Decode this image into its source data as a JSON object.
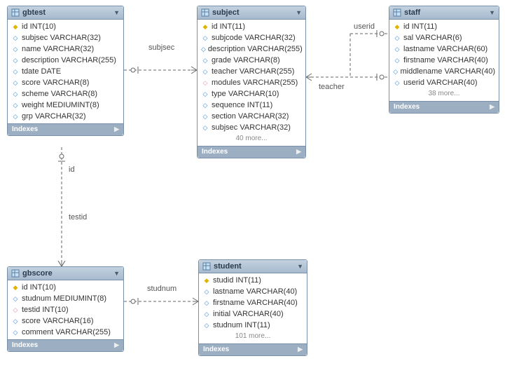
{
  "tables": {
    "gbtest": {
      "title": "gbtest",
      "columns": [
        {
          "icon": "pk",
          "text": "id INT(10)"
        },
        {
          "icon": "fld",
          "text": "subjsec VARCHAR(32)"
        },
        {
          "icon": "fld",
          "text": "name VARCHAR(32)"
        },
        {
          "icon": "fld",
          "text": "description VARCHAR(255)"
        },
        {
          "icon": "fld",
          "text": "tdate DATE"
        },
        {
          "icon": "fld",
          "text": "score VARCHAR(8)"
        },
        {
          "icon": "fld",
          "text": "scheme VARCHAR(8)"
        },
        {
          "icon": "fld",
          "text": "weight MEDIUMINT(8)"
        },
        {
          "icon": "fld",
          "text": "grp VARCHAR(32)"
        }
      ],
      "more": null,
      "footer": "Indexes"
    },
    "subject": {
      "title": "subject",
      "columns": [
        {
          "icon": "pk",
          "text": "id INT(11)"
        },
        {
          "icon": "fld",
          "text": "subjcode VARCHAR(32)"
        },
        {
          "icon": "fld",
          "text": "description VARCHAR(255)"
        },
        {
          "icon": "fld",
          "text": "grade VARCHAR(8)"
        },
        {
          "icon": "fld",
          "text": "teacher VARCHAR(255)"
        },
        {
          "icon": "fld-open",
          "text": "modules VARCHAR(255)"
        },
        {
          "icon": "fld",
          "text": "type VARCHAR(10)"
        },
        {
          "icon": "fld",
          "text": "sequence INT(11)"
        },
        {
          "icon": "fld",
          "text": "section VARCHAR(32)"
        },
        {
          "icon": "fld",
          "text": "subjsec VARCHAR(32)"
        }
      ],
      "more": "40 more...",
      "footer": "Indexes"
    },
    "staff": {
      "title": "staff",
      "columns": [
        {
          "icon": "pk",
          "text": "id INT(11)"
        },
        {
          "icon": "fld",
          "text": "sal VARCHAR(6)"
        },
        {
          "icon": "fld",
          "text": "lastname VARCHAR(60)"
        },
        {
          "icon": "fld",
          "text": "firstname VARCHAR(40)"
        },
        {
          "icon": "fld",
          "text": "middlename VARCHAR(40)"
        },
        {
          "icon": "fld",
          "text": "userid VARCHAR(40)"
        }
      ],
      "more": "38 more...",
      "footer": "Indexes"
    },
    "gbscore": {
      "title": "gbscore",
      "columns": [
        {
          "icon": "pk",
          "text": "id INT(10)"
        },
        {
          "icon": "fld",
          "text": "studnum MEDIUMINT(8)"
        },
        {
          "icon": "fld-open",
          "text": "testid INT(10)"
        },
        {
          "icon": "fld",
          "text": "score VARCHAR(16)"
        },
        {
          "icon": "fld",
          "text": "comment VARCHAR(255)"
        }
      ],
      "more": null,
      "footer": "Indexes"
    },
    "student": {
      "title": "student",
      "columns": [
        {
          "icon": "pk",
          "text": "studid INT(11)"
        },
        {
          "icon": "fld",
          "text": "lastname VARCHAR(40)"
        },
        {
          "icon": "fld",
          "text": "firstname VARCHAR(40)"
        },
        {
          "icon": "fld",
          "text": "initial VARCHAR(40)"
        },
        {
          "icon": "fld",
          "text": "studnum INT(11)"
        }
      ],
      "more": "101 more...",
      "footer": "Indexes"
    }
  },
  "labels": {
    "subjsec": "subjsec",
    "userid": "userid",
    "teacher": "teacher",
    "id": "id",
    "testid": "testid",
    "studnum": "studnum"
  }
}
